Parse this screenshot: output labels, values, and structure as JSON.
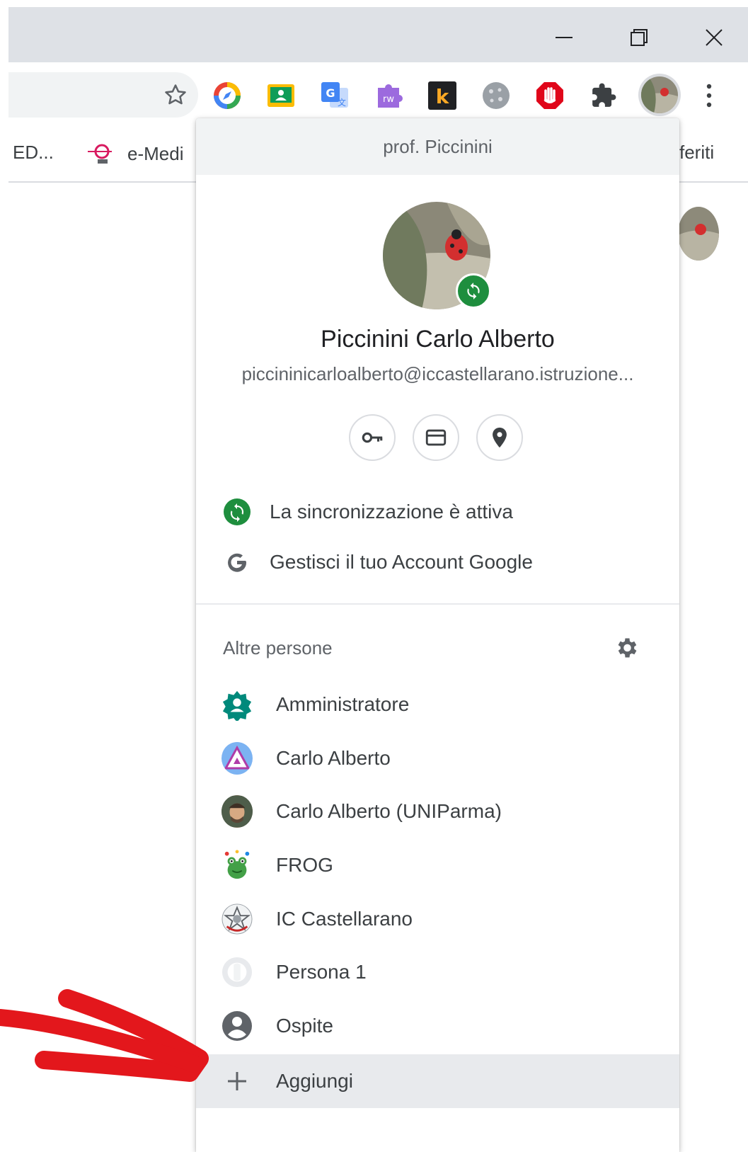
{
  "bookmarks": {
    "items": [
      {
        "label": "ED..."
      },
      {
        "label": "e-Medi"
      },
      {
        "label": "feriti"
      }
    ]
  },
  "profile_menu": {
    "header": "prof. Piccinini",
    "user_name": "Piccinini Carlo Alberto",
    "user_email": "piccininicarloalberto@iccastellarano.istruzione...",
    "sync_status": "La sincronizzazione è attiva",
    "manage_account": "Gestisci il tuo Account Google",
    "other_people_title": "Altre persone",
    "people": [
      {
        "label": "Amministratore",
        "icon": "admin-gear-avatar"
      },
      {
        "label": "Carlo Alberto",
        "icon": "triangle-avatar"
      },
      {
        "label": "Carlo Alberto (UNIParma)",
        "icon": "photo-avatar"
      },
      {
        "label": "FROG",
        "icon": "frog-avatar"
      },
      {
        "label": "IC Castellarano",
        "icon": "emblem-avatar"
      },
      {
        "label": "Persona 1",
        "icon": "default-avatar"
      }
    ],
    "guest": "Ospite",
    "add": "Aggiungi"
  },
  "colors": {
    "titlebar": "#dee1e6",
    "sync_green": "#1e8e3e",
    "hover": "#e8eaed",
    "annotation_arrow": "#e3171c"
  }
}
